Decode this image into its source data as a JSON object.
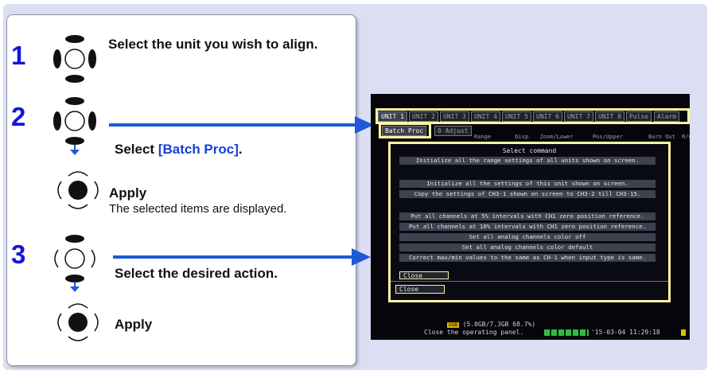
{
  "colors": {
    "step_number": "#1515d8",
    "highlight": "#1540d8",
    "arrow": "#1f59d6",
    "frame": "#fff4a6"
  },
  "steps": [
    {
      "number": "1",
      "icon": "dial-knob-icon",
      "text": "Select the unit you wish to align."
    },
    {
      "number": "2",
      "icon": "dial-knob-icon",
      "text_prefix": "Select ",
      "text_highlight": "[Batch Proc]",
      "text_suffix": ".",
      "apply_icon": "enter-button-icon",
      "apply_label": "Apply",
      "apply_note": "The selected items are displayed."
    },
    {
      "number": "3",
      "icon": "dial-knob-icon",
      "text": "Select the desired action.",
      "apply_icon": "enter-button-icon",
      "apply_label": "Apply"
    }
  ],
  "screen": {
    "tabs": [
      "UNIT 1",
      "UNIT 2",
      "UNIT 3",
      "UNIT 4",
      "UNIT 5",
      "UNIT 6",
      "UNIT 7",
      "UNIT 8",
      "Pulse",
      "Alarm"
    ],
    "sub_tabs": [
      "Batch Proc",
      "0 Adjust"
    ],
    "column_headers": [
      "Range",
      "Disp.",
      "Zoom/Lower",
      "Pos/Upper",
      "Burn Out",
      "R/C"
    ],
    "dialog": {
      "title": "Select command",
      "items": [
        "Initialize all the range settings of all units shown on screen.",
        "Initialize all the settings of this unit shown on screen.",
        "Copy the settings of CH3-1 shown on screen to CH3-2 till CH3-15.",
        "Put all channels at 5% intervals with CH1 zero position reference.",
        "Put all channels at 10% intervals with CH1 zero position reference.",
        "Set all analog channels color off",
        "Set all analog channels color default",
        "Correct max/min values to the same as CH-1 when input type is same."
      ],
      "inner_close": "Close",
      "outer_close": "Close"
    },
    "status": {
      "usb_badge": "USB",
      "storage": "(5.0GB/7.3GB 68.7%)",
      "message": "Close the operating panel.",
      "timestamp": "'15-03-04 11:29:18"
    }
  }
}
